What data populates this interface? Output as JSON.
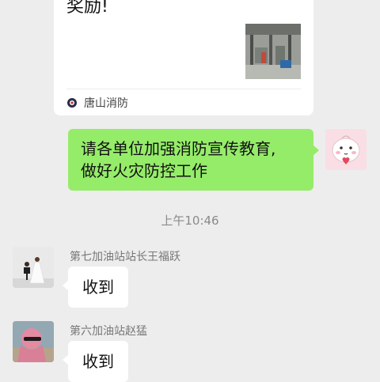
{
  "shared_card": {
    "text_tail": "奖励!",
    "source_label": "唐山消防",
    "thumbnail_icon": "factory-photo-thumbnail",
    "source_icon": "fire-department-logo-icon"
  },
  "outgoing_message": {
    "text": "请各单位加强消防宣传教育,\n做好火灾防控工作",
    "bubble_color": "#95ec69",
    "avatar_icon": "cartoon-character-avatar"
  },
  "timestamp": "上午10:46",
  "incoming_messages": [
    {
      "sender": "第七加油站站长王福跃",
      "text": "收到",
      "avatar_icon": "wedding-photo-avatar"
    },
    {
      "sender": "第六加油站赵猛",
      "text": "收到",
      "avatar_icon": "pink-hood-avatar"
    }
  ],
  "colors": {
    "chat_background": "#ededed",
    "incoming_bubble": "#ffffff",
    "timestamp_text": "#8a8a8a"
  }
}
